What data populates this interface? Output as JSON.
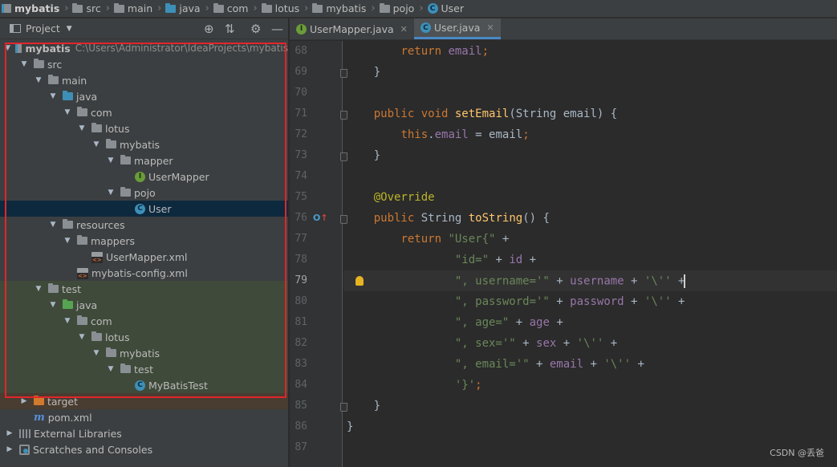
{
  "breadcrumb": [
    {
      "label": "mybatis",
      "icon": "module-icon"
    },
    {
      "label": "src",
      "icon": "folder-icon"
    },
    {
      "label": "main",
      "icon": "folder-icon"
    },
    {
      "label": "java",
      "icon": "source-folder-icon"
    },
    {
      "label": "com",
      "icon": "package-icon"
    },
    {
      "label": "lotus",
      "icon": "package-icon"
    },
    {
      "label": "mybatis",
      "icon": "package-icon"
    },
    {
      "label": "pojo",
      "icon": "package-icon"
    },
    {
      "label": "User",
      "icon": "class-icon"
    }
  ],
  "project_panel": {
    "title": "Project",
    "tree": [
      {
        "label": "mybatis",
        "path": "C:\\Users\\Administrator\\IdeaProjects\\mybatis",
        "icon": "module-icon",
        "indent": 0,
        "expanded": true,
        "bold": true
      },
      {
        "label": "src",
        "icon": "folder-icon",
        "indent": 1,
        "expanded": true
      },
      {
        "label": "main",
        "icon": "folder-icon",
        "indent": 2,
        "expanded": true
      },
      {
        "label": "java",
        "icon": "source-folder-icon",
        "indent": 3,
        "expanded": true
      },
      {
        "label": "com",
        "icon": "package-icon",
        "indent": 4,
        "expanded": true
      },
      {
        "label": "lotus",
        "icon": "package-icon",
        "indent": 5,
        "expanded": true
      },
      {
        "label": "mybatis",
        "icon": "package-icon",
        "indent": 6,
        "expanded": true
      },
      {
        "label": "mapper",
        "icon": "package-icon",
        "indent": 7,
        "expanded": true
      },
      {
        "label": "UserMapper",
        "icon": "interface-icon",
        "indent": 8
      },
      {
        "label": "pojo",
        "icon": "package-icon",
        "indent": 7,
        "expanded": true
      },
      {
        "label": "User",
        "icon": "class-icon",
        "indent": 8,
        "selected": true
      },
      {
        "label": "resources",
        "icon": "resources-folder-icon",
        "indent": 3,
        "expanded": true
      },
      {
        "label": "mappers",
        "icon": "folder-icon",
        "indent": 4,
        "expanded": true
      },
      {
        "label": "UserMapper.xml",
        "icon": "xml-file-icon",
        "indent": 5
      },
      {
        "label": "mybatis-config.xml",
        "icon": "xml-file-icon",
        "indent": 4
      },
      {
        "label": "test",
        "icon": "folder-icon",
        "indent": 2,
        "expanded": true,
        "test": true
      },
      {
        "label": "java",
        "icon": "test-source-folder-icon",
        "indent": 3,
        "expanded": true,
        "test": true
      },
      {
        "label": "com",
        "icon": "package-icon",
        "indent": 4,
        "expanded": true,
        "test": true
      },
      {
        "label": "lotus",
        "icon": "package-icon",
        "indent": 5,
        "expanded": true,
        "test": true
      },
      {
        "label": "mybatis",
        "icon": "package-icon",
        "indent": 6,
        "expanded": true,
        "test": true
      },
      {
        "label": "test",
        "icon": "package-icon",
        "indent": 7,
        "expanded": true,
        "test": true
      },
      {
        "label": "MyBatisTest",
        "icon": "test-class-icon",
        "indent": 8,
        "test": true
      },
      {
        "label": "target",
        "icon": "excluded-folder-icon",
        "indent": 1,
        "expanded": false,
        "target": true
      },
      {
        "label": "pom.xml",
        "icon": "maven-icon",
        "indent": 1
      },
      {
        "label": "External Libraries",
        "icon": "libraries-icon",
        "indent": 0,
        "expanded": false
      },
      {
        "label": "Scratches and Consoles",
        "icon": "scratches-icon",
        "indent": 0,
        "expanded": false
      }
    ]
  },
  "tabs": [
    {
      "label": "UserMapper.java",
      "icon": "interface-icon",
      "active": false
    },
    {
      "label": "User.java",
      "icon": "class-icon",
      "active": true
    }
  ],
  "editor": {
    "current_line": "79",
    "lines": [
      {
        "num": "68",
        "fold": false,
        "tokens": [
          [
            "",
            "        "
          ],
          [
            "kw",
            "return "
          ],
          [
            "fld",
            "email"
          ],
          [
            "kw",
            ";"
          ]
        ]
      },
      {
        "num": "69",
        "fold": true,
        "tokens": [
          [
            "",
            "    }"
          ]
        ]
      },
      {
        "num": "70",
        "fold": false,
        "tokens": []
      },
      {
        "num": "71",
        "fold": true,
        "tokens": [
          [
            "",
            "    "
          ],
          [
            "kw",
            "public void "
          ],
          [
            "fn",
            "setEmail"
          ],
          [
            "",
            "(String email) {"
          ]
        ]
      },
      {
        "num": "72",
        "fold": false,
        "tokens": [
          [
            "",
            "        "
          ],
          [
            "kw",
            "this"
          ],
          [
            "",
            "."
          ],
          [
            "fld",
            "email"
          ],
          [
            "",
            " = email"
          ],
          [
            "kw",
            ";"
          ]
        ]
      },
      {
        "num": "73",
        "fold": true,
        "tokens": [
          [
            "",
            "    }"
          ]
        ]
      },
      {
        "num": "74",
        "fold": false,
        "tokens": []
      },
      {
        "num": "75",
        "fold": false,
        "tokens": [
          [
            "",
            "    "
          ],
          [
            "ann",
            "@Override"
          ]
        ]
      },
      {
        "num": "76",
        "fold": true,
        "override": true,
        "tokens": [
          [
            "",
            "    "
          ],
          [
            "kw",
            "public "
          ],
          [
            "",
            "String "
          ],
          [
            "fn",
            "toString"
          ],
          [
            "",
            "() {"
          ]
        ]
      },
      {
        "num": "77",
        "fold": false,
        "tokens": [
          [
            "",
            "        "
          ],
          [
            "kw",
            "return "
          ],
          [
            "str",
            "\"User{\""
          ],
          [
            "",
            " +"
          ]
        ]
      },
      {
        "num": "78",
        "fold": false,
        "tokens": [
          [
            "",
            "                "
          ],
          [
            "str",
            "\"id=\""
          ],
          [
            "",
            " + "
          ],
          [
            "fld",
            "id"
          ],
          [
            "",
            " +"
          ]
        ]
      },
      {
        "num": "79",
        "fold": false,
        "bulb": true,
        "current": true,
        "tokens": [
          [
            "",
            "                "
          ],
          [
            "str",
            "\", username='\""
          ],
          [
            "",
            " + "
          ],
          [
            "fld",
            "username"
          ],
          [
            "",
            " + "
          ],
          [
            "str",
            "'\\''"
          ],
          [
            "",
            " +"
          ]
        ]
      },
      {
        "num": "80",
        "fold": false,
        "tokens": [
          [
            "",
            "                "
          ],
          [
            "str",
            "\", password='\""
          ],
          [
            "",
            " + "
          ],
          [
            "fld",
            "password"
          ],
          [
            "",
            " + "
          ],
          [
            "str",
            "'\\''"
          ],
          [
            "",
            " +"
          ]
        ]
      },
      {
        "num": "81",
        "fold": false,
        "tokens": [
          [
            "",
            "                "
          ],
          [
            "str",
            "\", age=\""
          ],
          [
            "",
            " + "
          ],
          [
            "fld",
            "age"
          ],
          [
            "",
            " +"
          ]
        ]
      },
      {
        "num": "82",
        "fold": false,
        "tokens": [
          [
            "",
            "                "
          ],
          [
            "str",
            "\", sex='\""
          ],
          [
            "",
            " + "
          ],
          [
            "fld",
            "sex"
          ],
          [
            "",
            " + "
          ],
          [
            "str",
            "'\\''"
          ],
          [
            "",
            " +"
          ]
        ]
      },
      {
        "num": "83",
        "fold": false,
        "tokens": [
          [
            "",
            "                "
          ],
          [
            "str",
            "\", email='\""
          ],
          [
            "",
            " + "
          ],
          [
            "fld",
            "email"
          ],
          [
            "",
            " + "
          ],
          [
            "str",
            "'\\''"
          ],
          [
            "",
            " +"
          ]
        ]
      },
      {
        "num": "84",
        "fold": false,
        "tokens": [
          [
            "",
            "                "
          ],
          [
            "str",
            "'}'"
          ],
          [
            "kw",
            ";"
          ]
        ]
      },
      {
        "num": "85",
        "fold": true,
        "tokens": [
          [
            "",
            "    }"
          ]
        ]
      },
      {
        "num": "86",
        "fold": false,
        "tokens": [
          [
            "",
            "}"
          ]
        ]
      },
      {
        "num": "87",
        "fold": false,
        "tokens": []
      }
    ]
  },
  "watermark": "CSDN @丢爸",
  "colors": {
    "keyword": "#cc7832",
    "method": "#ffc66d",
    "field": "#9876aa",
    "string": "#6a8759",
    "annotation": "#bbb529",
    "highlight_box": "#e0262b"
  }
}
